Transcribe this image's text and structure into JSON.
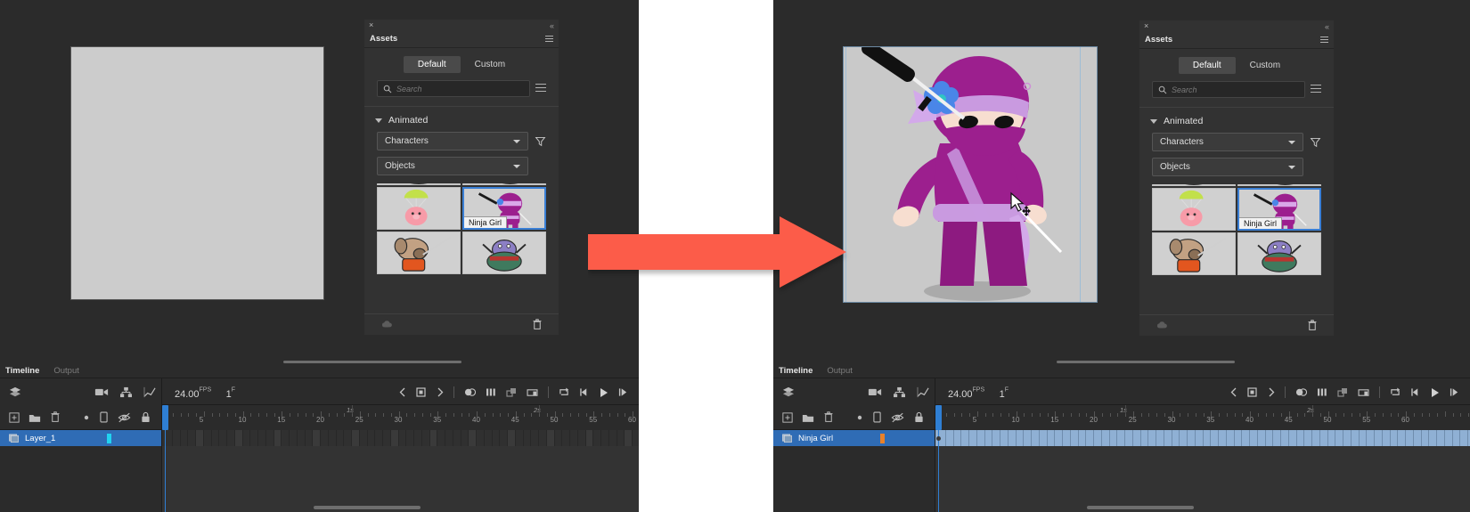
{
  "app": {
    "accent_blue": "#2f7fd4",
    "layer_row_blue": "#2f6cb5",
    "arrow_color": "#fc5c48",
    "panel_bg": "#323232",
    "stage_bg": "#2b2b2b",
    "canvas_fill": "#c9c9c9"
  },
  "arrow": {
    "name": "right-arrow",
    "color": "#fc5c48"
  },
  "assets_panel": {
    "title": "Assets",
    "close_glyph": "×",
    "collapse_glyph": "«",
    "tabs": [
      {
        "label": "Default",
        "active": true
      },
      {
        "label": "Custom",
        "active": false
      }
    ],
    "search": {
      "placeholder": "Search",
      "value": ""
    },
    "section": {
      "label": "Animated",
      "expanded": true
    },
    "dropdowns": [
      {
        "label": "Characters"
      },
      {
        "label": "Objects"
      }
    ],
    "filter_icon": "filter-icon",
    "list_view_icon": "list-view-icon",
    "assets": [
      {
        "name": "duck-partial-top-left",
        "label": "",
        "selected": false
      },
      {
        "name": "duck-partial-top-right",
        "label": "",
        "selected": false
      },
      {
        "name": "pig-parachute",
        "label": "",
        "selected": false
      },
      {
        "name": "ninja-girl",
        "label": "Ninja Girl",
        "selected": true
      },
      {
        "name": "dog-warrior",
        "label": "",
        "selected": false
      },
      {
        "name": "turtle-pirate",
        "label": "",
        "selected": false
      }
    ],
    "footer": {
      "left_icon": "cloud-download-icon",
      "right_icon": "trash-icon"
    }
  },
  "stage": {
    "left": {
      "name": "empty-canvas",
      "content": ""
    },
    "right": {
      "name": "canvas-with-ninja-girl",
      "character": "Ninja Girl",
      "cursor": "move-cursor"
    }
  },
  "timeline": {
    "tabs": [
      {
        "label": "Timeline",
        "active": true
      },
      {
        "label": "Output",
        "active": false
      }
    ],
    "fps": "24.00",
    "fps_unit": "FPS",
    "frame_number": "1",
    "frame_unit": "F",
    "toolbar_icons": [
      "layers-icon",
      "camera-icon",
      "rig-icon",
      "graph-editor-icon"
    ],
    "layer_tools": [
      "add-layer-icon",
      "new-folder-icon",
      "delete-layer-icon",
      "dot-icon",
      "device-icon",
      "eye-off-icon",
      "lock-icon"
    ],
    "playback_icons": [
      "prev-keyframe-icon",
      "insert-keyframe-icon",
      "next-keyframe-icon",
      "onion-skin-icon",
      "multiframe-icon",
      "edit-multiframe-icon",
      "anchor-onion-icon",
      "loop-icon",
      "step-back-icon",
      "play-icon",
      "step-forward-icon"
    ],
    "ruler": {
      "frame_ticks": [
        "5",
        "10",
        "15",
        "20",
        "25",
        "30",
        "35",
        "40",
        "45",
        "50",
        "55",
        "60"
      ],
      "second_marks": [
        "1s",
        "2s"
      ]
    },
    "left_layers": [
      {
        "name": "Layer_1",
        "selected": true,
        "keyframe_color": "#21d3f0",
        "has_frames": false
      }
    ],
    "right_layers": [
      {
        "name": "Ninja Girl",
        "selected": true,
        "keyframe_color": "#e8812a",
        "has_frames": true
      }
    ]
  }
}
